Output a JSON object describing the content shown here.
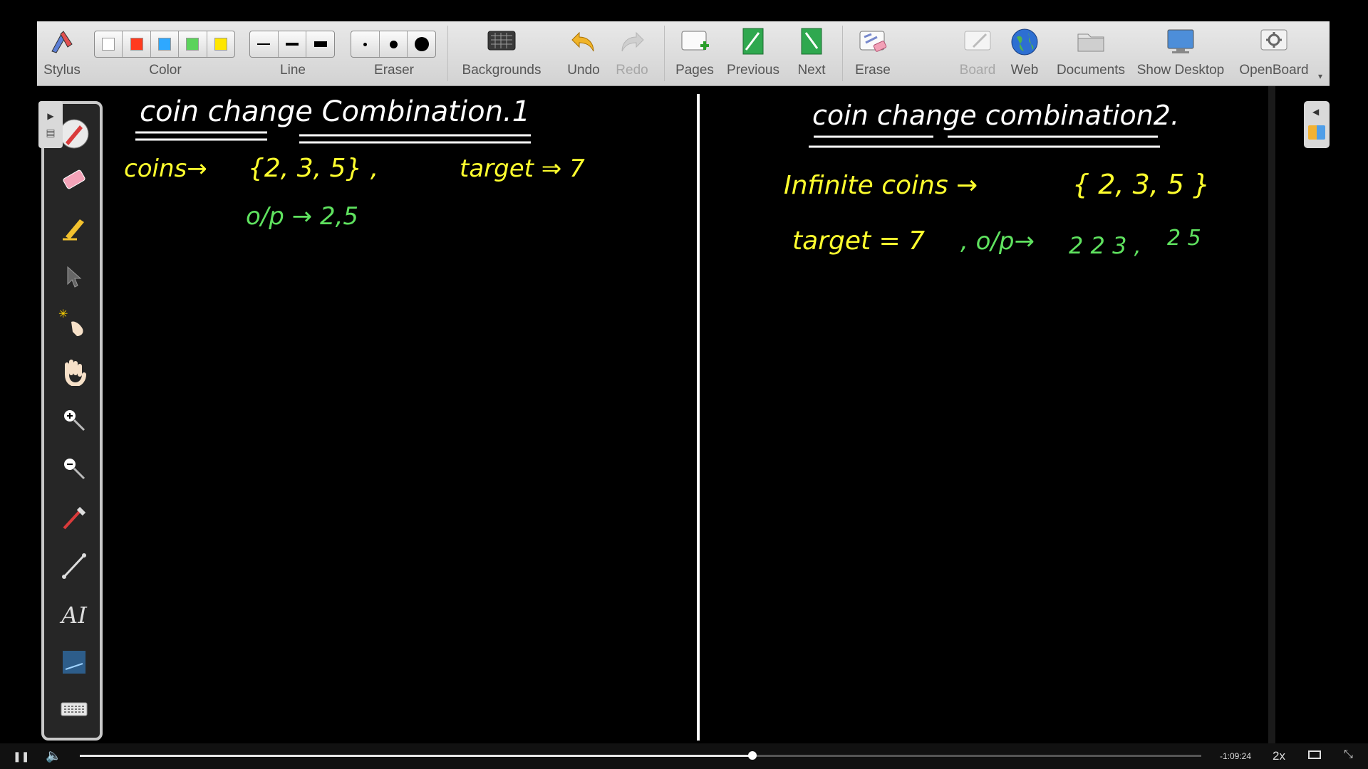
{
  "toolbar": {
    "stylus_label": "Stylus",
    "color_label": "Color",
    "line_label": "Line",
    "eraser_label": "Eraser",
    "backgrounds_label": "Backgrounds",
    "undo_label": "Undo",
    "redo_label": "Redo",
    "pages_label": "Pages",
    "previous_label": "Previous",
    "next_label": "Next",
    "erase_label": "Erase",
    "board_label": "Board",
    "web_label": "Web",
    "documents_label": "Documents",
    "show_desktop_label": "Show Desktop",
    "openboard_label": "OpenBoard",
    "colors": [
      "#ffffff",
      "#ff3b1f",
      "#2ea8ff",
      "#5bd35b",
      "#ffe600"
    ]
  },
  "palette": {
    "tools": [
      "pen-icon",
      "eraser-icon",
      "highlighter-icon",
      "pointer-icon",
      "laser-pointer-icon",
      "hand-icon",
      "zoom-in-icon",
      "zoom-out-icon",
      "color-picker-icon",
      "line-icon",
      "text-icon",
      "capture-icon",
      "keyboard-icon"
    ]
  },
  "board": {
    "left": {
      "title": "coin change Combination.1",
      "coins_label": "coins→",
      "coins_set": "{2, 3, 5} ,",
      "target_label": "target ⇒ 7",
      "output": "o/p →  2,5"
    },
    "right": {
      "title": "coin change combination2.",
      "infinite_label": "Infinite  coins   →",
      "coins_set": "{ 2, 3, 5 }",
      "target_label": "target = 7",
      "output_label": ", o/p→",
      "output_values": "2 2 3 ,",
      "output_values2": "2 5"
    },
    "ink_colors": {
      "title": "#ffffff",
      "yellow": "#ffff2e",
      "green": "#5fe25f"
    }
  },
  "video": {
    "time_remaining": "-1:09:24",
    "speed": "2x",
    "progress": 0.6
  }
}
